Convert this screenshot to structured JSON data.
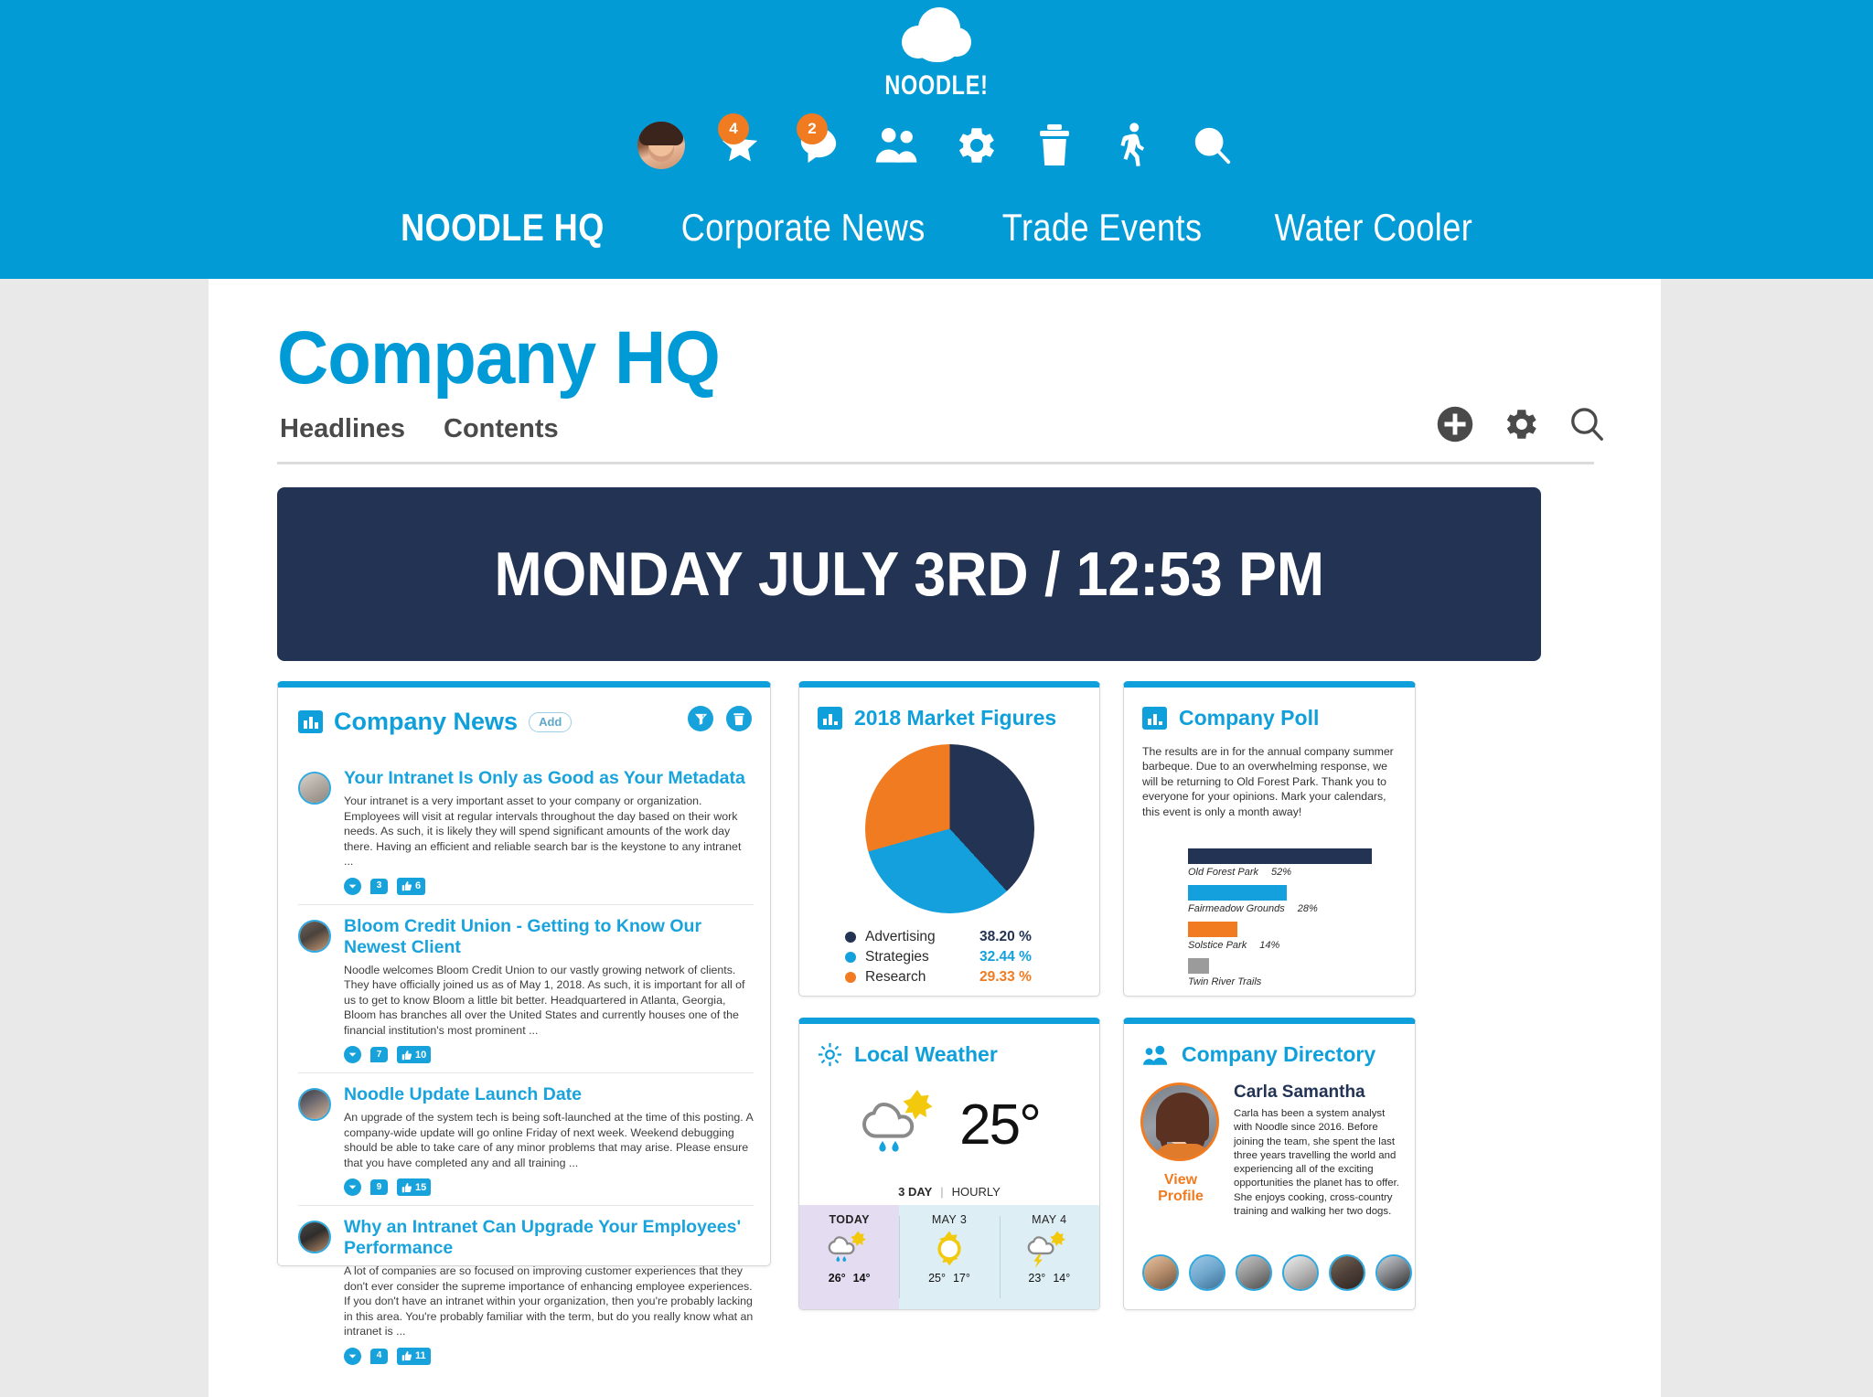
{
  "header": {
    "brand_name": "NOODLE!",
    "logo_icon": "cloud-icon",
    "icons": [
      {
        "name": "user-avatar",
        "badge": null
      },
      {
        "name": "star-icon",
        "badge": "4"
      },
      {
        "name": "chat-bubble-icon",
        "badge": "2"
      },
      {
        "name": "people-icon",
        "badge": null
      },
      {
        "name": "gear-icon",
        "badge": null
      },
      {
        "name": "trash-icon",
        "badge": null
      },
      {
        "name": "walking-person-icon",
        "badge": null
      },
      {
        "name": "search-icon",
        "badge": null
      }
    ],
    "nav": [
      {
        "label": "NOODLE HQ",
        "active": true
      },
      {
        "label": "Corporate News",
        "active": false
      },
      {
        "label": "Trade Events",
        "active": false
      },
      {
        "label": "Water Cooler",
        "active": false
      }
    ],
    "bg_color": "#039BD5"
  },
  "page": {
    "title": "Company HQ",
    "tabs": [
      {
        "label": "Headlines"
      },
      {
        "label": "Contents"
      }
    ],
    "actions": [
      {
        "name": "add-button",
        "icon": "plus-circle-icon"
      },
      {
        "name": "settings-button",
        "icon": "gear-icon"
      },
      {
        "name": "search-button",
        "icon": "search-icon"
      }
    ],
    "date_banner": "MONDAY JULY 3RD / 12:53 PM",
    "banner_color": "#233354"
  },
  "news": {
    "title": "Company News",
    "icon": "newspaper-icon",
    "add_label": "Add",
    "actions": [
      {
        "name": "filter-button",
        "icon": "filter-icon"
      },
      {
        "name": "delete-button",
        "icon": "trash-icon"
      }
    ],
    "items": [
      {
        "title": "Your Intranet Is Only as Good as Your Metadata",
        "text": "Your intranet is a very important asset to your company or organization. Employees will visit at regular intervals throughout the day based on their work needs. As such, it is likely they will spend significant amounts of the work day there. Having an efficient and reliable search bar is the keystone to any intranet ...",
        "comments": "3",
        "likes": "6"
      },
      {
        "title": "Bloom Credit Union - Getting to Know Our Newest Client",
        "text": "Noodle welcomes Bloom Credit Union to our vastly growing network of clients. They have officially joined us as of May 1, 2018. As such, it is important for all of us to get to know Bloom a little bit better. Headquartered in Atlanta, Georgia, Bloom has branches all over the United States and currently houses one of the financial institution's most prominent ...",
        "comments": "7",
        "likes": "10"
      },
      {
        "title": "Noodle Update Launch Date",
        "text": "An upgrade of the system tech is being soft-launched at the time of this posting. A company-wide update will go online Friday of next week. Weekend debugging should be able to take care of any minor problems that may arise. Please ensure that you have completed any and all training ...",
        "comments": "9",
        "likes": "15"
      },
      {
        "title": "Why an Intranet Can Upgrade Your Employees' Performance",
        "text": "A lot of companies are so focused on improving customer experiences that they don't ever consider the supreme importance of enhancing employee experiences. If you don't have an intranet within your organization, then you're probably lacking in this area. You're probably familiar with the term, but do you really know what an intranet is ...",
        "comments": "4",
        "likes": "11"
      }
    ]
  },
  "market": {
    "title": "2018 Market Figures",
    "icon": "bar-chart-icon"
  },
  "poll": {
    "title": "Company Poll",
    "icon": "bar-chart-icon",
    "text": "The results are in for the annual company summer barbeque. Due to an overwhelming response, we will be returning to Old Forest Park. Thank you to everyone for your opinions. Mark your calendars, this event is only a month away!"
  },
  "weather": {
    "title": "Local Weather",
    "icon": "sun-icon",
    "current_temp": "25°",
    "current_condition": "rain-sun-icon",
    "toggle_3day": "3 DAY",
    "toggle_sep": "|",
    "toggle_hourly": "HOURLY",
    "days": [
      {
        "name": "TODAY",
        "icon": "rain-sun-icon",
        "high": "26°",
        "low": "14°",
        "today": true
      },
      {
        "name": "MAY 3",
        "icon": "sun-icon",
        "high": "25°",
        "low": "17°",
        "today": false
      },
      {
        "name": "MAY 4",
        "icon": "storm-sun-icon",
        "high": "23°",
        "low": "14°",
        "today": false
      }
    ]
  },
  "directory": {
    "title": "Company Directory",
    "icon": "people-icon",
    "person_name": "Carla Samantha",
    "bio": "Carla has been a system analyst with Noodle since 2016. Before joining the team, she spent the last three years travelling the world and experiencing all of the exciting opportunities the planet has to offer. She enjoys cooking, cross-country training and walking her two dogs.",
    "view_profile": "View Profile",
    "mini_avatars": 6
  },
  "chart_data": [
    {
      "type": "pie",
      "title": "2018 Market Figures",
      "categories": [
        "Advertising",
        "Strategies",
        "Research"
      ],
      "values": [
        38.2,
        32.44,
        29.33
      ],
      "value_labels": [
        "38.20 %",
        "32.44 %",
        "29.33 %"
      ],
      "colors": [
        "#233354",
        "#14A0DC",
        "#F07B21"
      ],
      "legend": "bottom-left"
    },
    {
      "type": "bar",
      "title": "Company Poll",
      "orientation": "horizontal",
      "categories": [
        "Old Forest Park",
        "Fairmeadow Grounds",
        "Solstice Park",
        "Twin River Trails"
      ],
      "values": [
        52,
        28,
        14,
        6
      ],
      "value_labels": [
        "52%",
        "28%",
        "14%",
        ""
      ],
      "colors": [
        "#233354",
        "#14A0DC",
        "#F07B21",
        "#9B9B9B"
      ],
      "xlabel": "",
      "ylabel": "",
      "grid": false
    }
  ]
}
